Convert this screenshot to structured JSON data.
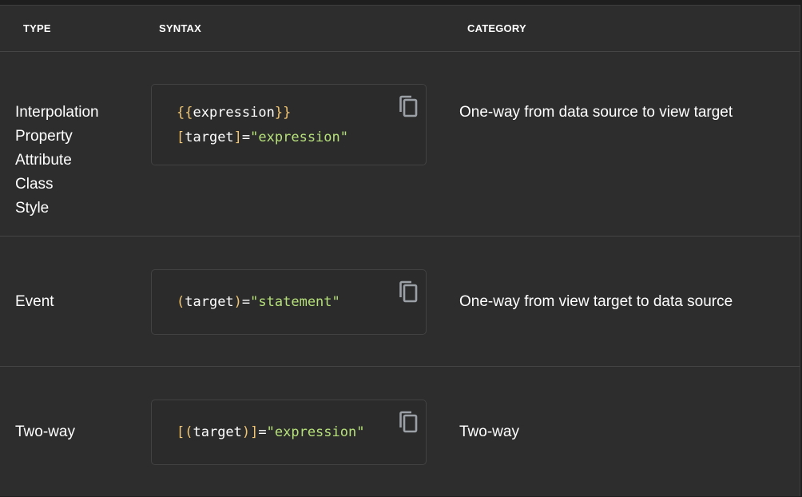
{
  "headers": {
    "type": "TYPE",
    "syntax": "SYNTAX",
    "category": "CATEGORY"
  },
  "rows": [
    {
      "types": [
        "Interpolation",
        "Property",
        "Attribute",
        "Class",
        "Style"
      ],
      "code": [
        [
          {
            "t": "{{",
            "k": "punc"
          },
          {
            "t": "expression",
            "k": "txt"
          },
          {
            "t": "}}",
            "k": "punc"
          }
        ],
        [
          {
            "t": "[",
            "k": "punc"
          },
          {
            "t": "target",
            "k": "txt"
          },
          {
            "t": "]",
            "k": "punc"
          },
          {
            "t": "=",
            "k": "txt"
          },
          {
            "t": "\"expression\"",
            "k": "str"
          }
        ]
      ],
      "category": "One-way from data source to view target"
    },
    {
      "types": [
        "Event"
      ],
      "code": [
        [
          {
            "t": "(",
            "k": "punc"
          },
          {
            "t": "target",
            "k": "txt"
          },
          {
            "t": ")",
            "k": "punc"
          },
          {
            "t": "=",
            "k": "txt"
          },
          {
            "t": "\"statement\"",
            "k": "str"
          }
        ]
      ],
      "category": "One-way from view target to data source"
    },
    {
      "types": [
        "Two-way"
      ],
      "code": [
        [
          {
            "t": "[(",
            "k": "punc"
          },
          {
            "t": "target",
            "k": "txt"
          },
          {
            "t": ")]",
            "k": "punc"
          },
          {
            "t": "=",
            "k": "txt"
          },
          {
            "t": "\"expression\"",
            "k": "str"
          }
        ]
      ],
      "category": "Two-way"
    }
  ],
  "icons": {
    "copy": "copy-icon"
  },
  "colors": {
    "punctuation": "#f0c674",
    "string": "#b5e07a",
    "text": "#ffffff",
    "table_bg": "#2d2d2d",
    "code_bg": "#2b2b2b",
    "icon": "#9aa0a6"
  }
}
